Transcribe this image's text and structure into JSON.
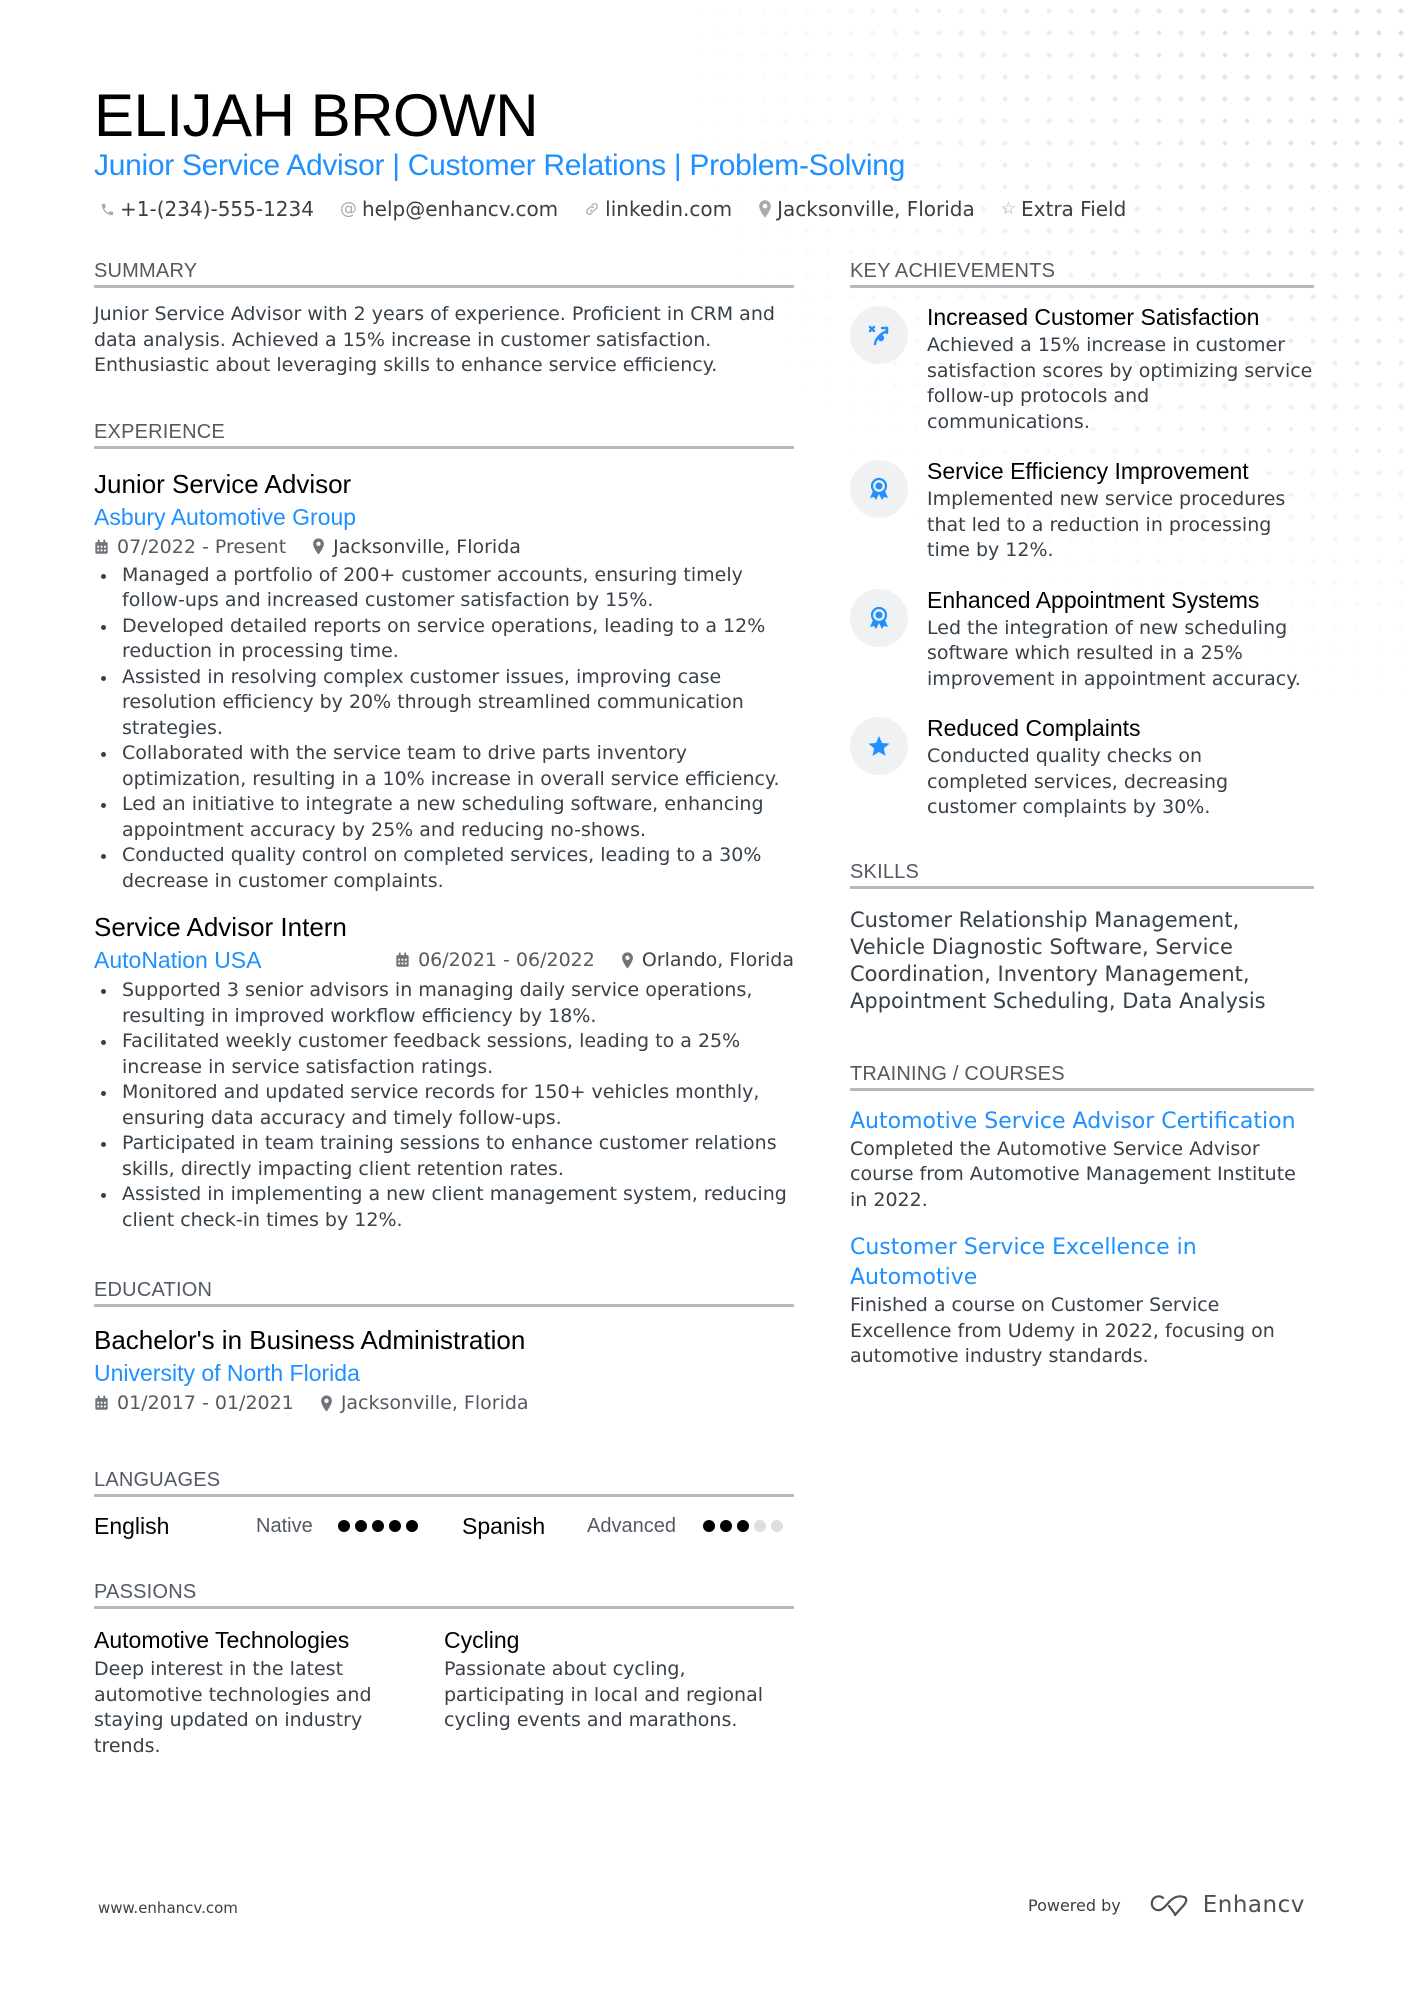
{
  "header": {
    "name": "ELIJAH BROWN",
    "tagline": "Junior Service Advisor | Customer Relations | Problem-Solving",
    "contacts": [
      {
        "icon": "phone-icon",
        "text": "+1-(234)-555-1234"
      },
      {
        "icon": "at-icon",
        "text": "help@enhancv.com"
      },
      {
        "icon": "link-icon",
        "text": "linkedin.com"
      },
      {
        "icon": "location-pin-icon",
        "text": "Jacksonville, Florida"
      },
      {
        "icon": "star-outline-icon",
        "text": "Extra Field"
      }
    ]
  },
  "summary": {
    "title": "SUMMARY",
    "text": "Junior Service Advisor with 2 years of experience. Proficient in CRM and data analysis. Achieved a 15% increase in customer satisfaction. Enthusiastic about leveraging skills to enhance service efficiency."
  },
  "experience": {
    "title": "EXPERIENCE",
    "jobs": [
      {
        "title": "Junior Service Advisor",
        "company": "Asbury Automotive Group",
        "dates": "07/2022 - Present",
        "location": "Jacksonville, Florida",
        "bullets": [
          "Managed a portfolio of 200+ customer accounts, ensuring timely follow-ups and increased customer satisfaction by 15%.",
          "Developed detailed reports on service operations, leading to a 12% reduction in processing time.",
          "Assisted in resolving complex customer issues, improving case resolution efficiency by 20% through streamlined communication strategies.",
          "Collaborated with the service team to drive parts inventory optimization, resulting in a 10% increase in overall service efficiency.",
          "Led an initiative to integrate a new scheduling software, enhancing appointment accuracy by 25% and reducing no-shows.",
          "Conducted quality control on completed services, leading to a 30% decrease in customer complaints."
        ]
      },
      {
        "title": "Service Advisor Intern",
        "company": "AutoNation USA",
        "dates": "06/2021 - 06/2022",
        "location": "Orlando, Florida",
        "bullets": [
          "Supported 3 senior advisors in managing daily service operations, resulting in improved workflow efficiency by 18%.",
          "Facilitated weekly customer feedback sessions, leading to a 25% increase in service satisfaction ratings.",
          "Monitored and updated service records for 150+ vehicles monthly, ensuring data accuracy and timely follow-ups.",
          "Participated in team training sessions to enhance customer relations skills, directly impacting client retention rates.",
          "Assisted in implementing a new client management system, reducing client check-in times by 12%."
        ]
      }
    ]
  },
  "education": {
    "title": "EDUCATION",
    "degree": "Bachelor's in Business Administration",
    "school": "University of North Florida",
    "dates": "01/2017 - 01/2021",
    "location": "Jacksonville, Florida"
  },
  "languages": {
    "title": "LANGUAGES",
    "items": [
      {
        "name": "English",
        "level": "Native",
        "rating": 5,
        "max": 5
      },
      {
        "name": "Spanish",
        "level": "Advanced",
        "rating": 3,
        "max": 5
      }
    ]
  },
  "passions": {
    "title": "PASSIONS",
    "items": [
      {
        "title": "Automotive Technologies",
        "desc": "Deep interest in the latest automotive technologies and staying updated on industry trends."
      },
      {
        "title": "Cycling",
        "desc": "Passionate about cycling, participating in local and regional cycling events and marathons."
      }
    ]
  },
  "achievements": {
    "title": "KEY ACHIEVEMENTS",
    "items": [
      {
        "icon": "strategy-arrow-icon",
        "title": "Increased Customer Satisfaction",
        "desc": "Achieved a 15% increase in customer satisfaction scores by optimizing service follow-up protocols and communications."
      },
      {
        "icon": "award-medal-icon",
        "title": "Service Efficiency Improvement",
        "desc": "Implemented new service procedures that led to a reduction in processing time by 12%."
      },
      {
        "icon": "award-medal-icon",
        "title": "Enhanced Appointment Systems",
        "desc": "Led the integration of new scheduling software which resulted in a 25% improvement in appointment accuracy."
      },
      {
        "icon": "star-icon",
        "title": "Reduced Complaints",
        "desc": "Conducted quality checks on completed services, decreasing customer complaints by 30%."
      }
    ]
  },
  "skills": {
    "title": "SKILLS",
    "text": "Customer Relationship Management, Vehicle Diagnostic Software, Service Coordination, Inventory Management, Appointment Scheduling, Data Analysis"
  },
  "training": {
    "title": "TRAINING / COURSES",
    "items": [
      {
        "title": "Automotive Service Advisor Certification",
        "desc": "Completed the Automotive Service Advisor course from Automotive Management Institute in 2022."
      },
      {
        "title": "Customer Service Excellence in Automotive",
        "desc": "Finished a course on Customer Service Excellence from Udemy in 2022, focusing on automotive industry standards."
      }
    ]
  },
  "footer": {
    "website": "www.enhancv.com",
    "powered_by": "Powered by",
    "brand": "Enhancv"
  },
  "colors": {
    "accent": "#1e90ff",
    "text": "#384048",
    "rule": "#b6babe",
    "dot_filled": "#000000",
    "dot_empty": "#dcdfe2"
  }
}
